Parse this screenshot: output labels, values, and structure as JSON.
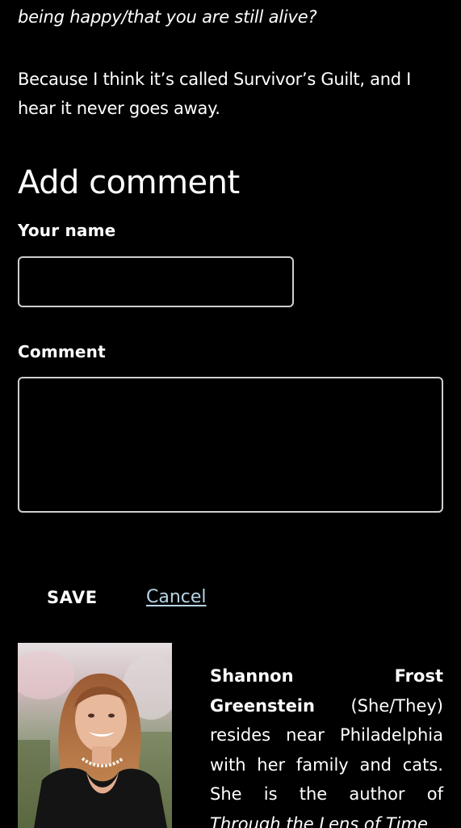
{
  "article": {
    "cut_line": "being happy/that you are still alive?",
    "paragraph": "Because I think it’s called Survivor’s Guilt, and I hear it never goes away."
  },
  "comment_form": {
    "heading": "Add comment",
    "name_label": "Your name",
    "name_value": "",
    "comment_label": "Comment",
    "comment_value": "",
    "save_label": "SAVE",
    "cancel_label": "Cancel"
  },
  "author": {
    "name": "Shannon Frost Greenstein",
    "pronouns": "(She/They)",
    "bio": "resides near Philadelphia with her family and cats. She is the author of",
    "book": "Through the Lens of Time"
  },
  "colors": {
    "background": "#000000",
    "text": "#ffffff",
    "link": "#b9d4e6",
    "input_border": "#cfcfcf"
  }
}
